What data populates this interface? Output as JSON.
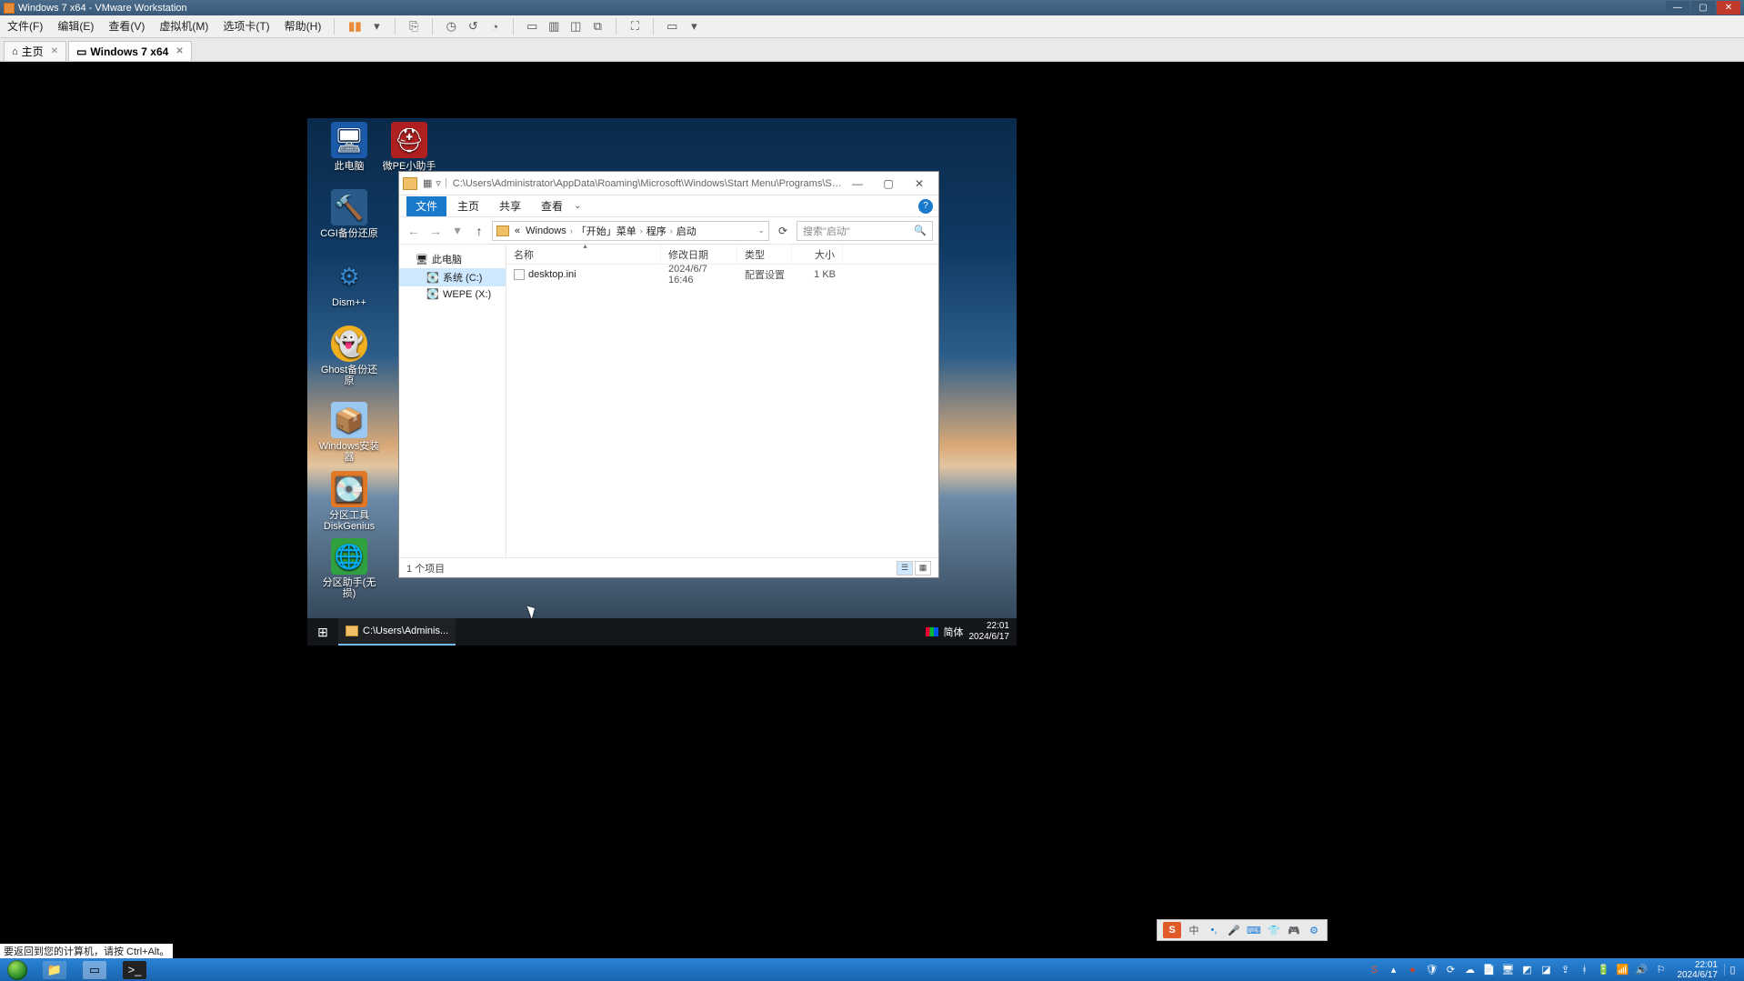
{
  "vmware": {
    "title": "Windows 7 x64 - VMware Workstation",
    "menu": [
      "文件(F)",
      "编辑(E)",
      "查看(V)",
      "虚拟机(M)",
      "选项卡(T)",
      "帮助(H)"
    ],
    "tabs": {
      "home": "主页",
      "vm": "Windows 7 x64"
    }
  },
  "desktop_icons": [
    {
      "label": "此电脑",
      "emoji": "🖥",
      "bg": "#1a5aa8"
    },
    {
      "label": "微PE小助手",
      "emoji": "⛑",
      "bg": "#e0e0e0"
    },
    {
      "label": "CGI备份还原",
      "emoji": "🔨",
      "bg": "#2a5a8a"
    },
    {
      "label": "Dism++",
      "emoji": "⚙",
      "bg": "transparent"
    },
    {
      "label": "Ghost备份还原",
      "emoji": "👻",
      "bg": "#f0b020"
    },
    {
      "label": "Windows安装器",
      "emoji": "📦",
      "bg": "#9ac8f0"
    },
    {
      "label": "分区工具DiskGenius",
      "emoji": "💽",
      "bg": "#e07828"
    },
    {
      "label": "分区助手(无损)",
      "emoji": "🌐",
      "bg": "#30a040"
    }
  ],
  "explorer": {
    "title_path": "C:\\Users\\Administrator\\AppData\\Roaming\\Microsoft\\Windows\\Start Menu\\Programs\\St...",
    "ribbon": {
      "file": "文件",
      "home": "主页",
      "share": "共享",
      "view": "查看"
    },
    "crumbs": [
      "«",
      "Windows",
      "「开始」菜单",
      "程序",
      "启动"
    ],
    "search_placeholder": "搜索\"启动\"",
    "tree": [
      {
        "label": "此电脑",
        "icon": "🖥"
      },
      {
        "label": "系统 (C:)",
        "icon": "💽",
        "sel": true
      },
      {
        "label": "WEPE (X:)",
        "icon": "💽"
      }
    ],
    "cols": {
      "name": "名称",
      "date": "修改日期",
      "type": "类型",
      "size": "大小"
    },
    "rows": [
      {
        "name": "desktop.ini",
        "date": "2024/6/7 16:46",
        "type": "配置设置",
        "size": "1 KB"
      }
    ],
    "status": "1 个项目"
  },
  "guest_taskbar": {
    "item": "C:\\Users\\Adminis...",
    "ime": "简体",
    "time": "22:01",
    "date": "2024/6/17"
  },
  "ime_bar": {
    "label_cn": "中"
  },
  "host": {
    "hint": "要返回到您的计算机，请按 Ctrl+Alt。",
    "time": "22:01",
    "date": "2024/6/17"
  }
}
